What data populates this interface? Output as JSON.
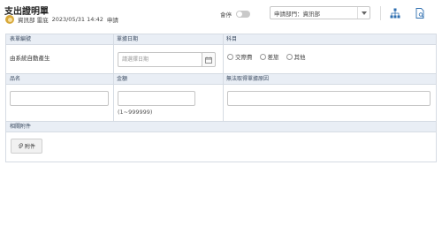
{
  "header": {
    "title": "支出證明單",
    "author": "資訊部 雷底",
    "datetime": "2023/05/31 14:42",
    "status": "申請",
    "toggle_label": "會停",
    "dept_select_value": "申請部門：資訊部"
  },
  "form": {
    "row1": {
      "doc_no_label": "表單編號",
      "doc_no_value": "由系統自動產生",
      "date_label": "單據日期",
      "date_placeholder": "請選擇日期",
      "category_label": "科目",
      "category_options": [
        "交際費",
        "差旅",
        "其他"
      ]
    },
    "row2": {
      "item_label": "品名",
      "amount_label": "金額",
      "amount_hint": "(1~999999)",
      "reason_label": "無法取得單據原因"
    },
    "attachments": {
      "label": "相關附件",
      "button_label": "附件"
    }
  },
  "colors": {
    "header_bg": "#e9eef5",
    "border": "#d5dbe3",
    "avatar": "#d8a93b"
  }
}
